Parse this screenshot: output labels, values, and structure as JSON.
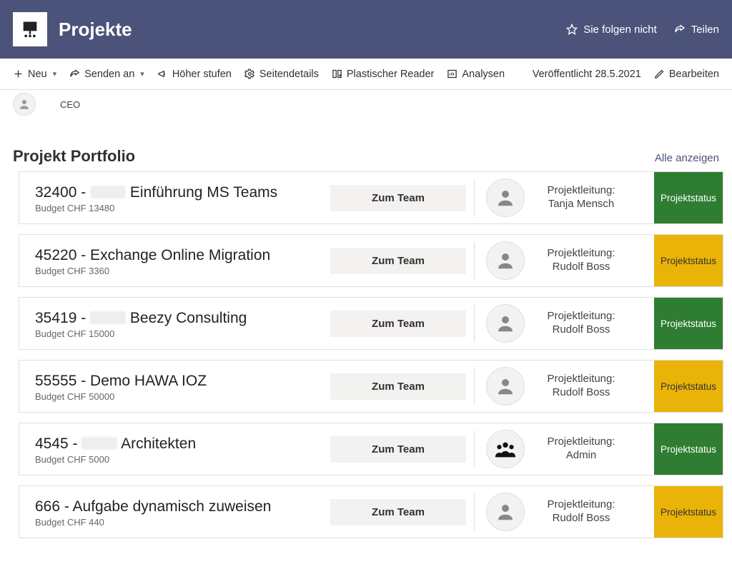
{
  "header": {
    "site_title": "Projekte",
    "follow_label": "Sie folgen nicht",
    "share_label": "Teilen"
  },
  "cmdbar": {
    "new": "Neu",
    "send_to": "Senden an",
    "promote": "Höher stufen",
    "page_details": "Seitendetails",
    "immersive_reader": "Plastischer Reader",
    "analytics": "Analysen",
    "published": "Veröffentlicht 28.5.2021",
    "edit": "Bearbeiten"
  },
  "author": {
    "role": "CEO"
  },
  "section": {
    "title": "Projekt Portfolio",
    "see_all": "Alle anzeigen"
  },
  "labels": {
    "budget_prefix": "Budget CHF ",
    "team_button": "Zum Team",
    "lead_label": "Projektleitung:",
    "status": "Projektstatus"
  },
  "projects": [
    {
      "id": "32400",
      "name_prefix": "32400 - ",
      "name_redacted": true,
      "name_tail": " Einführung MS Teams",
      "budget": "13480",
      "lead": "Tanja Mensch",
      "status": "green"
    },
    {
      "id": "45220",
      "name_prefix": "45220 - Exchange Online Migration",
      "name_redacted": false,
      "name_tail": "",
      "budget": "3360",
      "lead": "Rudolf Boss",
      "status": "yellow"
    },
    {
      "id": "35419",
      "name_prefix": "35419 - ",
      "name_redacted": true,
      "name_tail": " Beezy Consulting",
      "budget": "15000",
      "lead": "Rudolf Boss",
      "status": "green"
    },
    {
      "id": "55555",
      "name_prefix": "55555 - Demo HAWA IOZ",
      "name_redacted": false,
      "name_tail": "",
      "budget": "50000",
      "lead": "Rudolf Boss",
      "status": "yellow"
    },
    {
      "id": "4545",
      "name_prefix": "4545 - ",
      "name_redacted": true,
      "name_tail": " Architekten",
      "budget": "5000",
      "lead": "Admin",
      "status": "green"
    },
    {
      "id": "666",
      "name_prefix": "666 - Aufgabe dynamisch zuweisen",
      "name_redacted": false,
      "name_tail": "",
      "budget": "440",
      "lead": "Rudolf Boss",
      "status": "yellow"
    }
  ]
}
